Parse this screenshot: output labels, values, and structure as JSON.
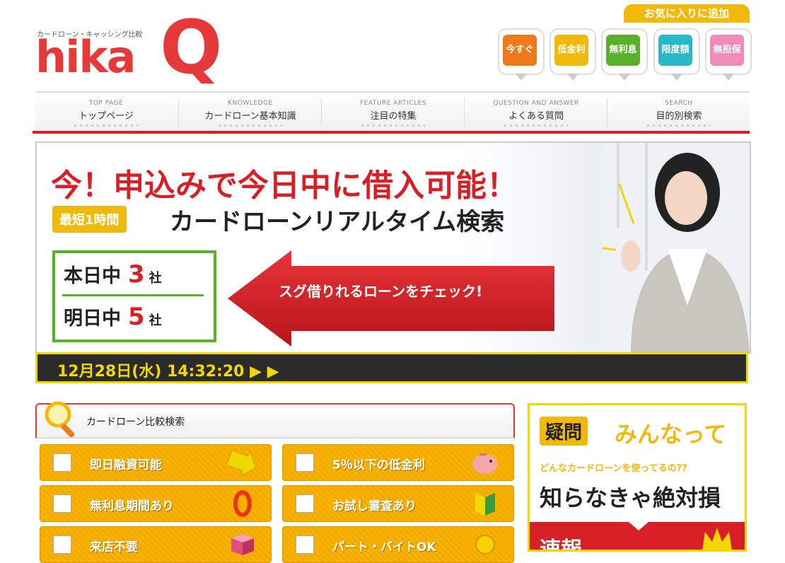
{
  "header": {
    "logo_tagline": "カードローン・キャッシング比較",
    "logo_text": "hika",
    "logo_q": "Q",
    "favorite_label": "お気に入りに追加",
    "quick_tags": [
      {
        "label": "今すぐ",
        "color": "#f07a1a"
      },
      {
        "label": "低金利",
        "color": "#f0b90b"
      },
      {
        "label": "無利息",
        "color": "#5ab02b"
      },
      {
        "label": "限度額",
        "color": "#28b8c8"
      },
      {
        "label": "無担保",
        "color": "#f08ab8"
      }
    ]
  },
  "nav": {
    "items": [
      {
        "en": "TOP PAGE",
        "ja": "トップページ"
      },
      {
        "en": "KNOWLEDGE",
        "ja": "カードローン基本知識"
      },
      {
        "en": "FEATURE ARTICLES",
        "ja": "注目の特集"
      },
      {
        "en": "QUESTION AND ANSWER",
        "ja": "よくある質問"
      },
      {
        "en": "SEARCH",
        "ja": "目的別検索"
      }
    ]
  },
  "banner": {
    "headline": "今！申込みで今日中に借入可能！",
    "badge": "最短1時間",
    "realtime_title": "カードローンリアルタイム検索",
    "today_label": "本日中",
    "today_count": "3",
    "tomorrow_label": "明日中",
    "tomorrow_count": "5",
    "company_unit": "社",
    "cta": "スグ借りれるローンをチェック!",
    "datetime": "12月28日(水) 14:32:20 ▶ ▶"
  },
  "search_panel": {
    "title": "カードローン比較検索",
    "options": [
      {
        "label": "即日融資可能",
        "icon": "arrow-icon"
      },
      {
        "label": "5％以下の低金利",
        "icon": "piggy-bank-icon"
      },
      {
        "label": "無利息期間あり",
        "icon": "zero-icon"
      },
      {
        "label": "お試し審査あり",
        "icon": "beginner-mark-icon"
      },
      {
        "label": "来店不要",
        "icon": "cube-icon"
      },
      {
        "label": "パート・バイトOK",
        "icon": "coin-icon"
      }
    ]
  },
  "side_box": {
    "question_badge": "疑問",
    "minna": "みんなって",
    "sub": "どんなカードローンを使ってるの??",
    "big": "知らなきゃ絶対損",
    "flash": "速報"
  }
}
